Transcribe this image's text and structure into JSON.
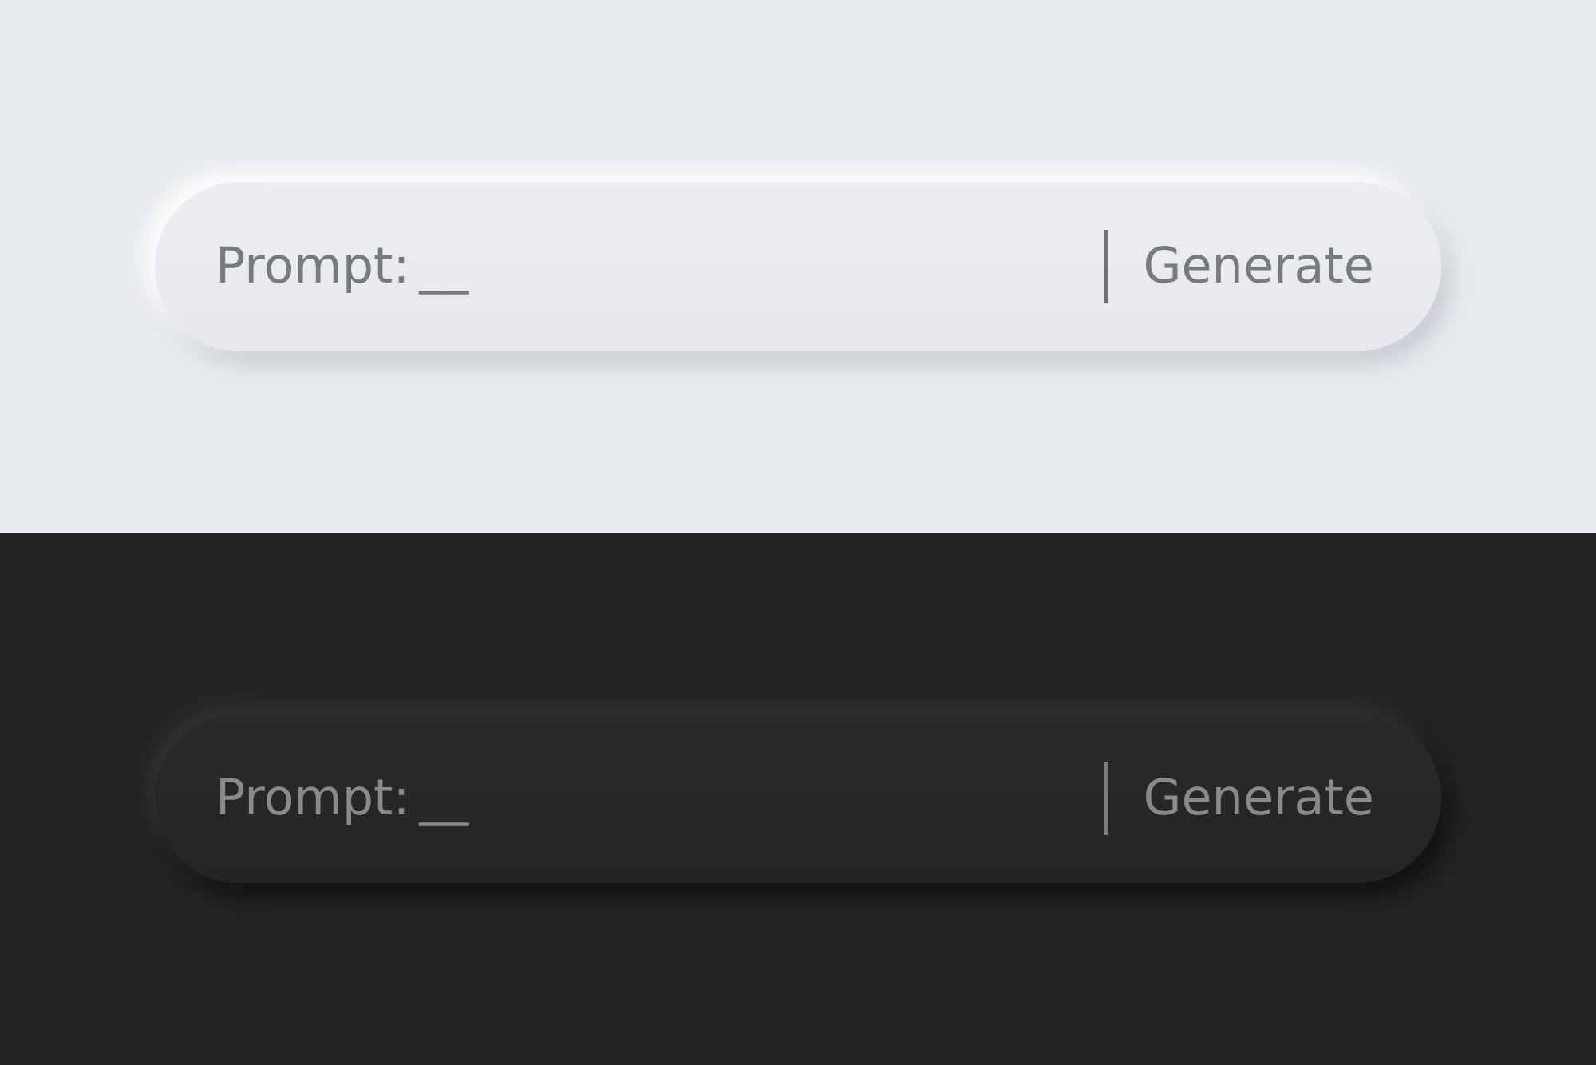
{
  "panels": [
    {
      "kind": "light",
      "label": "Prompt:",
      "value": "__",
      "button": "Generate"
    },
    {
      "kind": "dark",
      "label": "Prompt:",
      "value": "__",
      "button": "Generate"
    }
  ]
}
